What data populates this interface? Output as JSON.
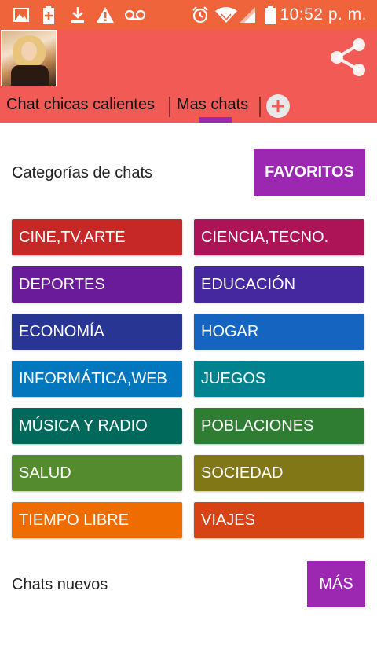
{
  "status_bar": {
    "time": "10:52 p. m.",
    "icons": [
      "image-icon",
      "battery-plus-icon",
      "download-icon",
      "warning-icon",
      "voicemail-icon",
      "alarm-icon",
      "wifi-icon",
      "signal-icon",
      "battery-icon"
    ]
  },
  "app_bar": {
    "tabs": [
      {
        "label": "Chat chicas calientes",
        "selected": false
      },
      {
        "label": "Mas chats",
        "selected": true
      }
    ],
    "accent_color": "#9c27b0",
    "bar_color": "#f15a55"
  },
  "categories_section": {
    "label": "Categorías de chats",
    "favorites_button": "FAVORITOS",
    "items": [
      {
        "label": "CINE,TV,ARTE",
        "color": "#c62828"
      },
      {
        "label": "CIENCIA,TECNO.",
        "color": "#ad1457"
      },
      {
        "label": "DEPORTES",
        "color": "#6a1b9a"
      },
      {
        "label": "EDUCACIÓN",
        "color": "#4527a0"
      },
      {
        "label": "ECONOMÍA",
        "color": "#283593"
      },
      {
        "label": "HOGAR",
        "color": "#1565c0"
      },
      {
        "label": "INFORMÁTICA,WEB",
        "color": "#0277bd"
      },
      {
        "label": "JUEGOS",
        "color": "#00838f"
      },
      {
        "label": "MÚSICA Y RADIO",
        "color": "#00695c"
      },
      {
        "label": "POBLACIONES",
        "color": "#2e7d32"
      },
      {
        "label": "SALUD",
        "color": "#558b2f"
      },
      {
        "label": "SOCIEDAD",
        "color": "#827717"
      },
      {
        "label": "TIEMPO LIBRE",
        "color": "#ef6c00"
      },
      {
        "label": "VIAJES",
        "color": "#d84315"
      }
    ]
  },
  "new_chats_section": {
    "label": "Chats nuevos",
    "more_button": "MÁS"
  }
}
